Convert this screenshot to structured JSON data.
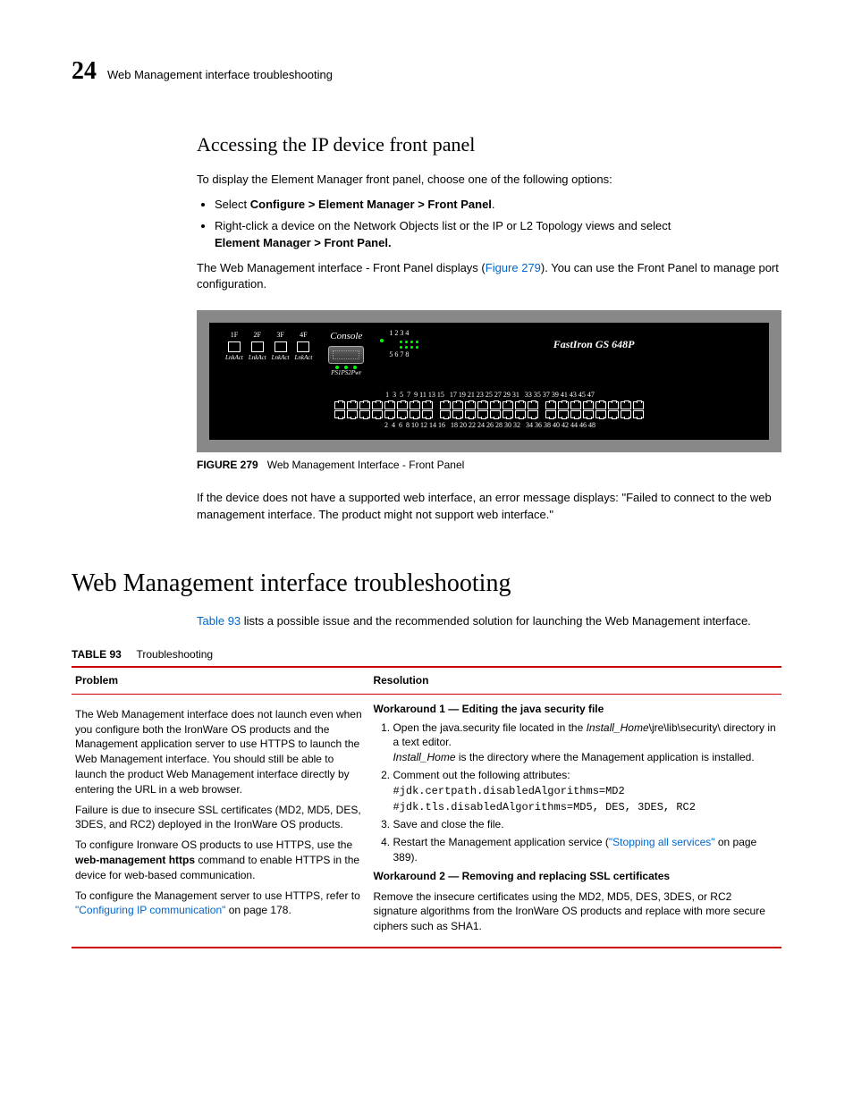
{
  "header": {
    "chapter": "24",
    "title": "Web Management interface troubleshooting"
  },
  "section1": {
    "heading": "Accessing the IP device front panel",
    "intro": "To display the Element Manager front panel, choose one of the following options:",
    "bullet1_pre": "Select ",
    "bullet1_bold": "Configure > Element Manager > Front Panel",
    "bullet1_post": ".",
    "bullet2a": "Right-click a device on the Network Objects list or the IP or L2 Topology views and select ",
    "bullet2b": "Element Manager > Front Panel.",
    "para2a": "The Web Management interface - Front Panel displays (",
    "para2_link": "Figure 279",
    "para2b": "). You can use the Front Panel to manage port configuration."
  },
  "figure": {
    "fans": [
      "1F",
      "2F",
      "3F",
      "4F"
    ],
    "fan_sub": "LnkAct",
    "console": "Console",
    "ps_label": "PS1PS2Pwr",
    "leds_top": "1 2 3 4",
    "leds_bot": "5 6 7 8",
    "model": "FastIron GS 648P",
    "ports_top": " 1  3  5  7  9 11 13 15   17 19 21 23 25 27 29 31   33 35 37 39 41 43 45 47",
    "ports_bot": " 2  4  6  8 10 12 14 16   18 20 22 24 26 28 30 32   34 36 38 40 42 44 46 48",
    "caption_label": "FIGURE 279",
    "caption_text": "Web Management Interface - Front Panel"
  },
  "para3": "If the device does not have a supported web interface, an error message displays: \"Failed to connect to the web management interface. The product might not support web interface.\"",
  "section2": {
    "heading": "Web Management interface troubleshooting",
    "intro_link": "Table 93",
    "intro_rest": " lists a possible issue and the recommended solution for launching the Web Management interface."
  },
  "table": {
    "label": "TABLE 93",
    "title": "Troubleshooting",
    "col1": "Problem",
    "col2": "Resolution",
    "problem": {
      "p1": "The Web Management interface does not launch even when you configure both the IronWare OS products and the Management application server to use HTTPS to launch the Web Management interface. You should still be able to launch the product Web Management interface directly by entering the URL in a web browser.",
      "p2": "Failure is due to insecure SSL certificates (MD2, MD5, DES, 3DES, and RC2) deployed in the IronWare OS products.",
      "p3a": "To configure Ironware OS products to use HTTPS, use the ",
      "p3b": "web-management https",
      "p3c": " command to enable HTTPS in the device for web-based communication.",
      "p4a": "To configure the Management server to use HTTPS, refer to ",
      "p4link": "\"Configuring IP communication\"",
      "p4b": " on page 178."
    },
    "resolution": {
      "w1_title": "Workaround 1 — Editing the java security file",
      "s1a": "Open the java.security file located in the ",
      "s1b": "Install_Home",
      "s1c": "\\jre\\lib\\security\\ directory in a text editor.",
      "s1d": "Install_Home",
      "s1e": " is the directory where the Management application is installed.",
      "s2": "Comment out the following attributes:",
      "s2a": "#jdk.certpath.disabledAlgorithms=MD2",
      "s2b": "#jdk.tls.disabledAlgorithms=MD5, DES, 3DES, RC2",
      "s3": "Save and close the file.",
      "s4a": "Restart the Management application service (",
      "s4link": "\"Stopping all services\"",
      "s4b": " on page 389).",
      "w2_title": "Workaround 2 — Removing and replacing SSL certificates",
      "w2_body": "Remove the insecure certificates using the MD2, MD5, DES, 3DES, or RC2 signature algorithms from the IronWare OS products and replace with more secure ciphers such as SHA1."
    }
  }
}
